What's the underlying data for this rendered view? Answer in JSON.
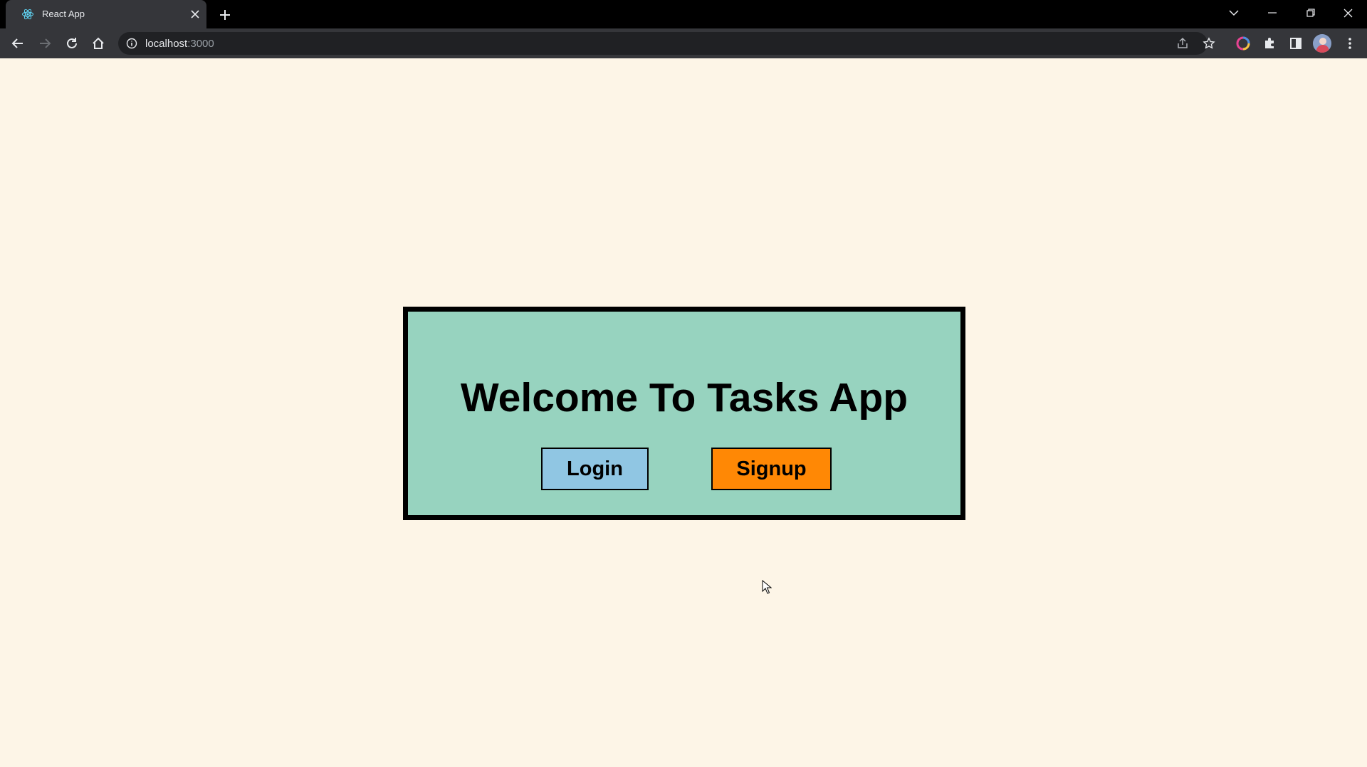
{
  "browser": {
    "tab": {
      "title": "React App",
      "favicon": "react-icon"
    },
    "address_bar": {
      "host": "localhost",
      "port": ":3000"
    },
    "window_controls": [
      "minimize",
      "restore",
      "close"
    ],
    "toolbar_icons": [
      "back-icon",
      "forward-icon",
      "reload-icon",
      "home-icon",
      "share-icon",
      "bookmark-star-icon",
      "extension-icon",
      "puzzle-icon",
      "side-panel-icon",
      "profile-avatar",
      "menu-icon"
    ]
  },
  "page": {
    "background": "#fdf5e7",
    "card": {
      "title": "Welcome To Tasks App",
      "background": "#97d3bf",
      "border_color": "#000000"
    },
    "buttons": {
      "login": {
        "label": "Login",
        "color": "#90c6e3"
      },
      "signup": {
        "label": "Signup",
        "color": "#ff8805"
      }
    }
  }
}
